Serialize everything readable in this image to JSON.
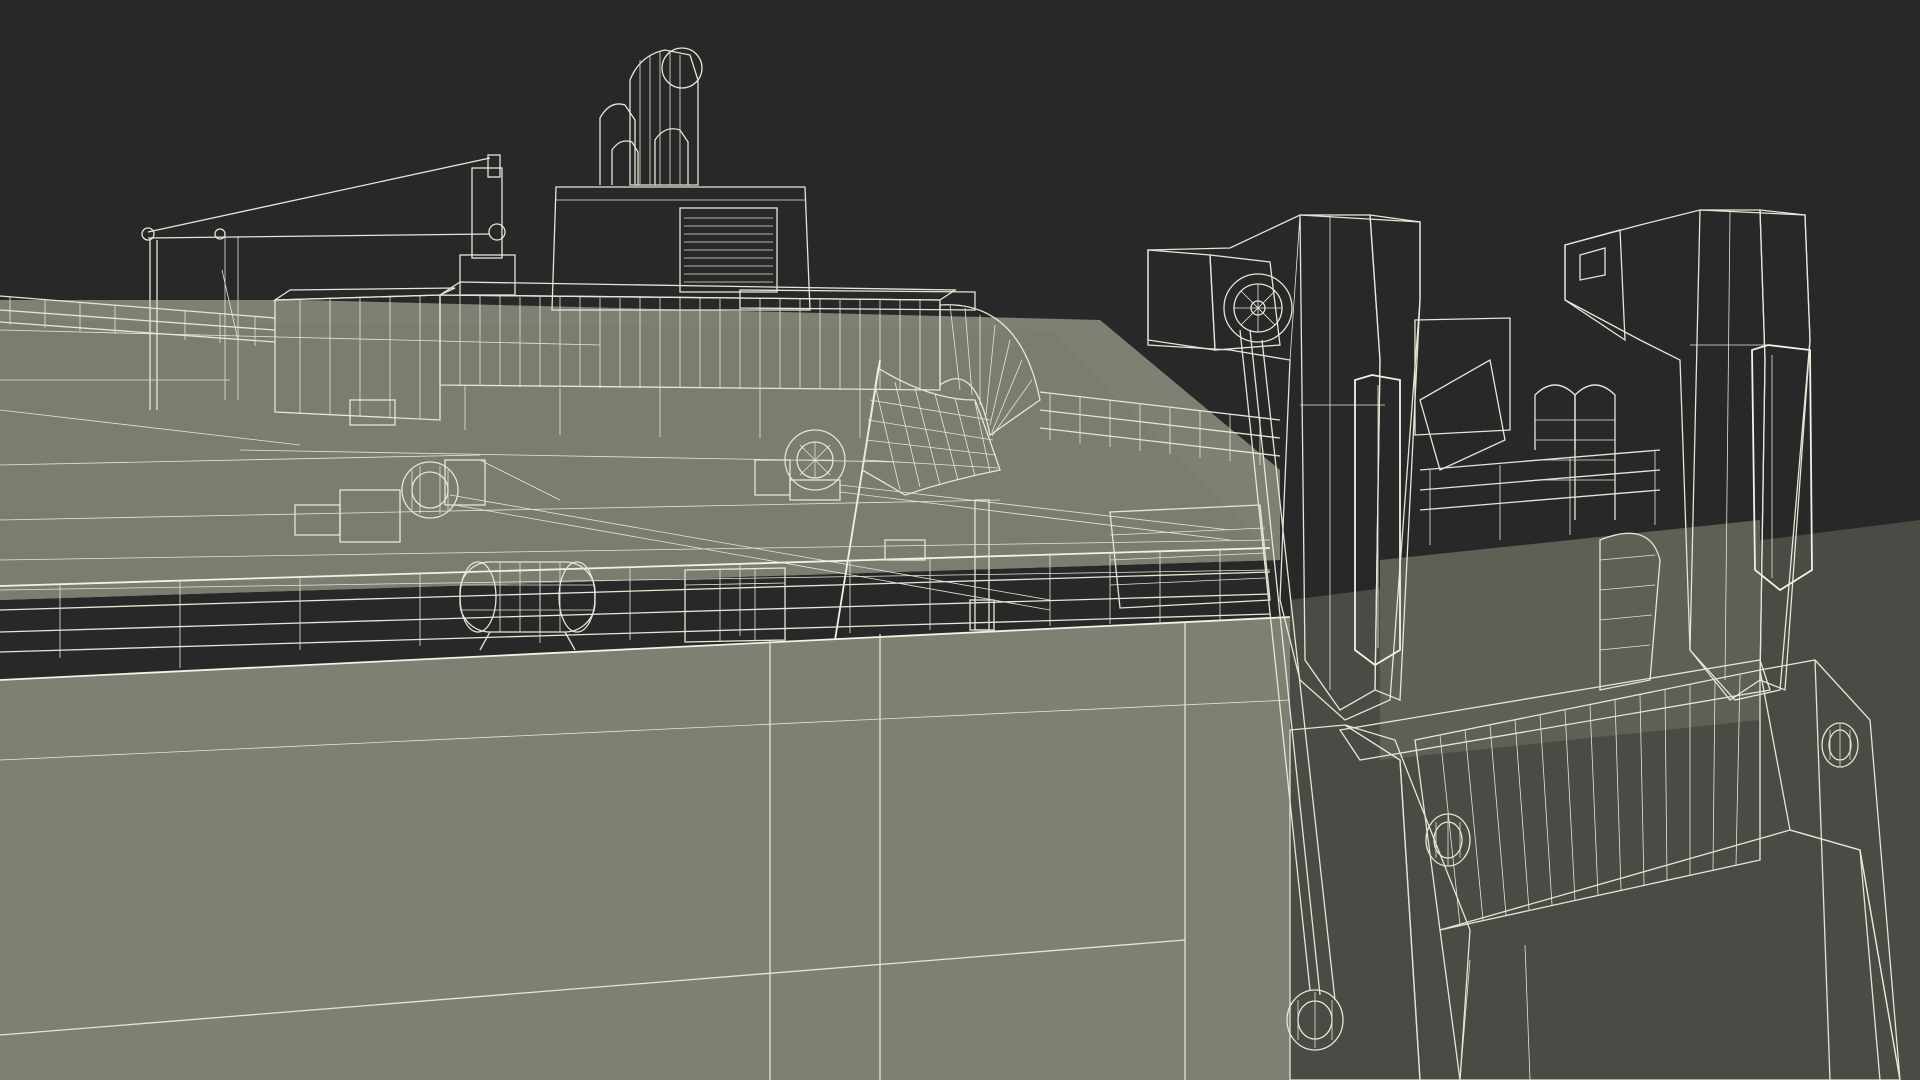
{
  "scene": {
    "description_hidden": "",
    "background_color": "#282828",
    "surface_color": "#7f8073",
    "surface_shadow_color": "#6c6d61",
    "surface_light_color": "#8d8e81",
    "wire_color": "#e4e6d6"
  }
}
